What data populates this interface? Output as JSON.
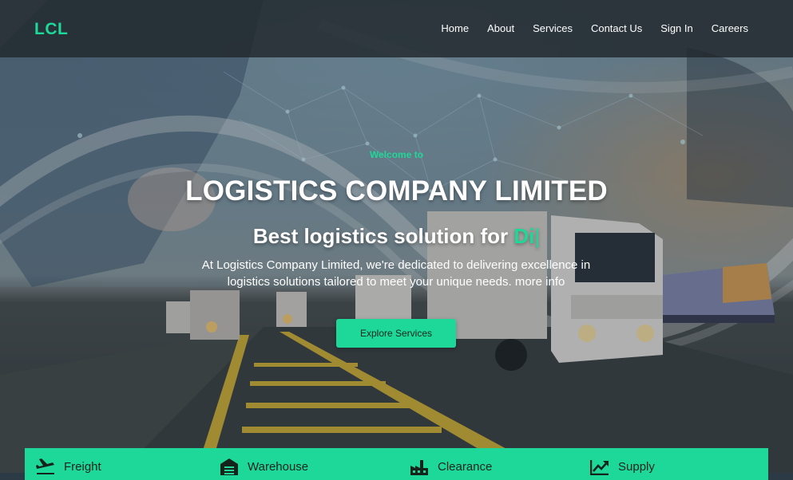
{
  "brand": {
    "logo": "LCL",
    "accent": "#1ed89a"
  },
  "nav": {
    "items": [
      {
        "label": "Home"
      },
      {
        "label": "About"
      },
      {
        "label": "Services"
      },
      {
        "label": "Contact Us"
      },
      {
        "label": "Sign In"
      },
      {
        "label": "Careers"
      }
    ]
  },
  "hero": {
    "welcome": "Welcome to",
    "title": "LOGISTICS COMPANY LIMITED",
    "tagline_prefix": "Best logistics solution for ",
    "tagline_typed": "Di",
    "tagline_cursor": "|",
    "description": "At Logistics Company Limited, we're dedicated to delivering excellence in logistics solutions tailored to meet your unique needs.",
    "more_info": "more info",
    "cta_label": "Explore Services"
  },
  "services": [
    {
      "label": "Freight",
      "icon": "airplane-icon"
    },
    {
      "label": "Warehouse",
      "icon": "warehouse-icon"
    },
    {
      "label": "Clearance",
      "icon": "factory-icon"
    },
    {
      "label": "Supply",
      "icon": "trending-up-icon"
    }
  ]
}
